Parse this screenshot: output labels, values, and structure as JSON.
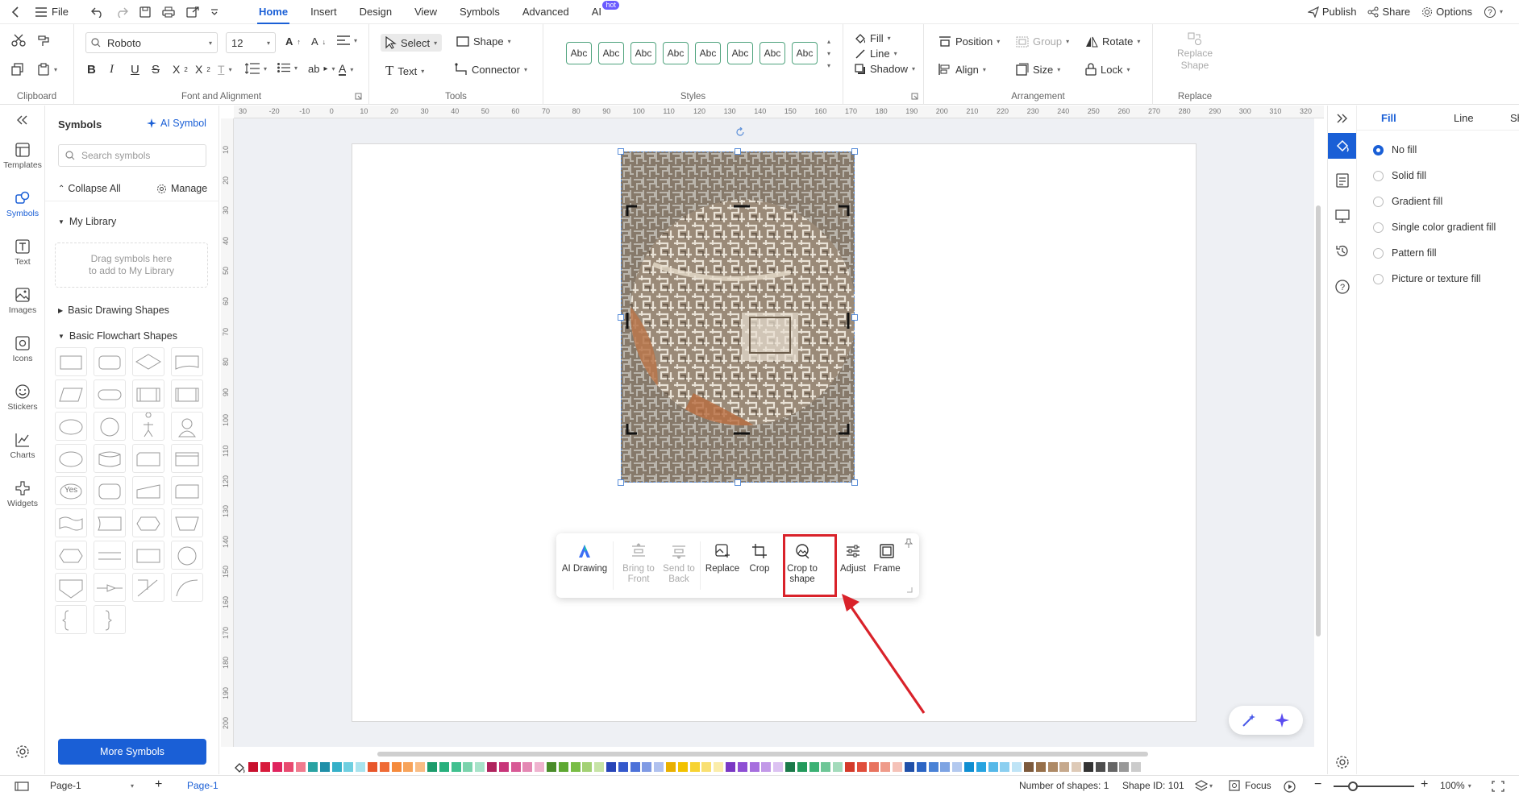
{
  "menubar": {
    "file_label": "File",
    "tabs": [
      "Home",
      "Insert",
      "Design",
      "View",
      "Symbols",
      "Advanced",
      "AI"
    ],
    "active_tab": "Home",
    "ai_badge": "hot",
    "publish": "Publish",
    "share": "Share",
    "options": "Options"
  },
  "ribbon": {
    "clipboard_label": "Clipboard",
    "font_name": "Roboto",
    "font_size": "12",
    "font_group_label": "Font and Alignment",
    "select": "Select",
    "shape": "Shape",
    "text": "Text",
    "connector": "Connector",
    "tools_label": "Tools",
    "styles": [
      "Abc",
      "Abc",
      "Abc",
      "Abc",
      "Abc",
      "Abc",
      "Abc",
      "Abc"
    ],
    "styles_label": "Styles",
    "fill": "Fill",
    "line": "Line",
    "shadow": "Shadow",
    "position": "Position",
    "group": "Group",
    "rotate": "Rotate",
    "align": "Align",
    "size": "Size",
    "lock": "Lock",
    "arrangement_label": "Arrangement",
    "replace_shape_line1": "Replace",
    "replace_shape_line2": "Shape",
    "replace_label": "Replace"
  },
  "leftrail": {
    "items": [
      "Templates",
      "Symbols",
      "Text",
      "Images",
      "Icons",
      "Stickers",
      "Charts",
      "Widgets"
    ],
    "active": "Symbols"
  },
  "symbols_panel": {
    "title": "Symbols",
    "ai_symbol": "AI Symbol",
    "search_placeholder": "Search symbols",
    "collapse_all": "Collapse All",
    "manage": "Manage",
    "my_library": "My Library",
    "drag_hint_line1": "Drag symbols here",
    "drag_hint_line2": "to add to My Library",
    "basic_drawing": "Basic Drawing Shapes",
    "basic_flowchart": "Basic Flowchart Shapes",
    "yes_label": "Yes",
    "more_symbols": "More Symbols"
  },
  "ruler": {
    "top_ticks": [
      "30",
      "-20",
      "-10",
      "0",
      "10",
      "20",
      "30",
      "40",
      "50",
      "60",
      "70",
      "80",
      "90",
      "100",
      "110",
      "120",
      "130",
      "140",
      "150",
      "160",
      "170",
      "180",
      "190",
      "200",
      "210",
      "220",
      "230",
      "240",
      "250",
      "260",
      "270",
      "280",
      "290",
      "300",
      "310",
      "320"
    ],
    "left_ticks": [
      "10",
      "20",
      "30",
      "40",
      "50",
      "60",
      "70",
      "80",
      "90",
      "100",
      "110",
      "120",
      "130",
      "140",
      "150",
      "160",
      "170",
      "180",
      "190",
      "200"
    ]
  },
  "float_toolbar": {
    "ai_drawing": "AI Drawing",
    "bring_front_1": "Bring to",
    "bring_front_2": "Front",
    "send_back_1": "Send to",
    "send_back_2": "Back",
    "replace": "Replace",
    "crop": "Crop",
    "crop_shape_1": "Crop to",
    "crop_shape_2": "shape",
    "adjust": "Adjust",
    "frame": "Frame"
  },
  "right_panel": {
    "tabs": [
      "Fill",
      "Line",
      "Shac"
    ],
    "active_tab": "Fill",
    "fill_options": [
      "No fill",
      "Solid fill",
      "Gradient fill",
      "Single color gradient fill",
      "Pattern fill",
      "Picture or texture fill"
    ],
    "selected": "No fill"
  },
  "statusbar": {
    "page_select": "Page-1",
    "page_tab": "Page-1",
    "num_shapes": "Number of shapes: 1",
    "shape_id": "Shape ID: 101",
    "focus": "Focus",
    "zoom": "100%"
  },
  "colors": {
    "accent": "#1a5fd6",
    "highlight": "#d9222a",
    "palette": [
      "#c8102e",
      "#d81b3c",
      "#e0245e",
      "#e84a6f",
      "#f07b8e",
      "#2aa3a3",
      "#1f8fa8",
      "#35b0c8",
      "#6fcfe0",
      "#a9e3ee",
      "#e8562a",
      "#ef6b35",
      "#f58a3c",
      "#f7a35a",
      "#f9bd85",
      "#1d9c6c",
      "#28b07d",
      "#40c08f",
      "#7ad3ac",
      "#a8e3c9",
      "#b0245e",
      "#c8367a",
      "#d85a96",
      "#e488b3",
      "#efb3cf",
      "#4a8c2a",
      "#5ea832",
      "#79bd45",
      "#a3d174",
      "#c7e4a6",
      "#2845b8",
      "#3559cc",
      "#4d72d9",
      "#7f9ae4",
      "#b0c1ef",
      "#e9b000",
      "#f2c200",
      "#f7d332",
      "#f9e072",
      "#fbedaa",
      "#7a38c4",
      "#8e4fd4",
      "#a66fde",
      "#c299e8",
      "#dcc2f2",
      "#1b7a4a",
      "#239a5c",
      "#3bb174",
      "#6ec697",
      "#a3dbbb",
      "#d43a2a",
      "#e04e3c",
      "#e8735f",
      "#ef9b8a",
      "#f5c2b8",
      "#2050a8",
      "#2c65c4",
      "#4a82d6",
      "#7ea4e3",
      "#b3c9ef",
      "#0f8ed1",
      "#28a4e0",
      "#55b8e8",
      "#8ccff0",
      "#bfe4f6",
      "#7d5a3c",
      "#97704a",
      "#ae8a66",
      "#c6a98d",
      "#decab7",
      "#333333",
      "#4d4d4d",
      "#666666",
      "#999999",
      "#cccccc"
    ]
  }
}
